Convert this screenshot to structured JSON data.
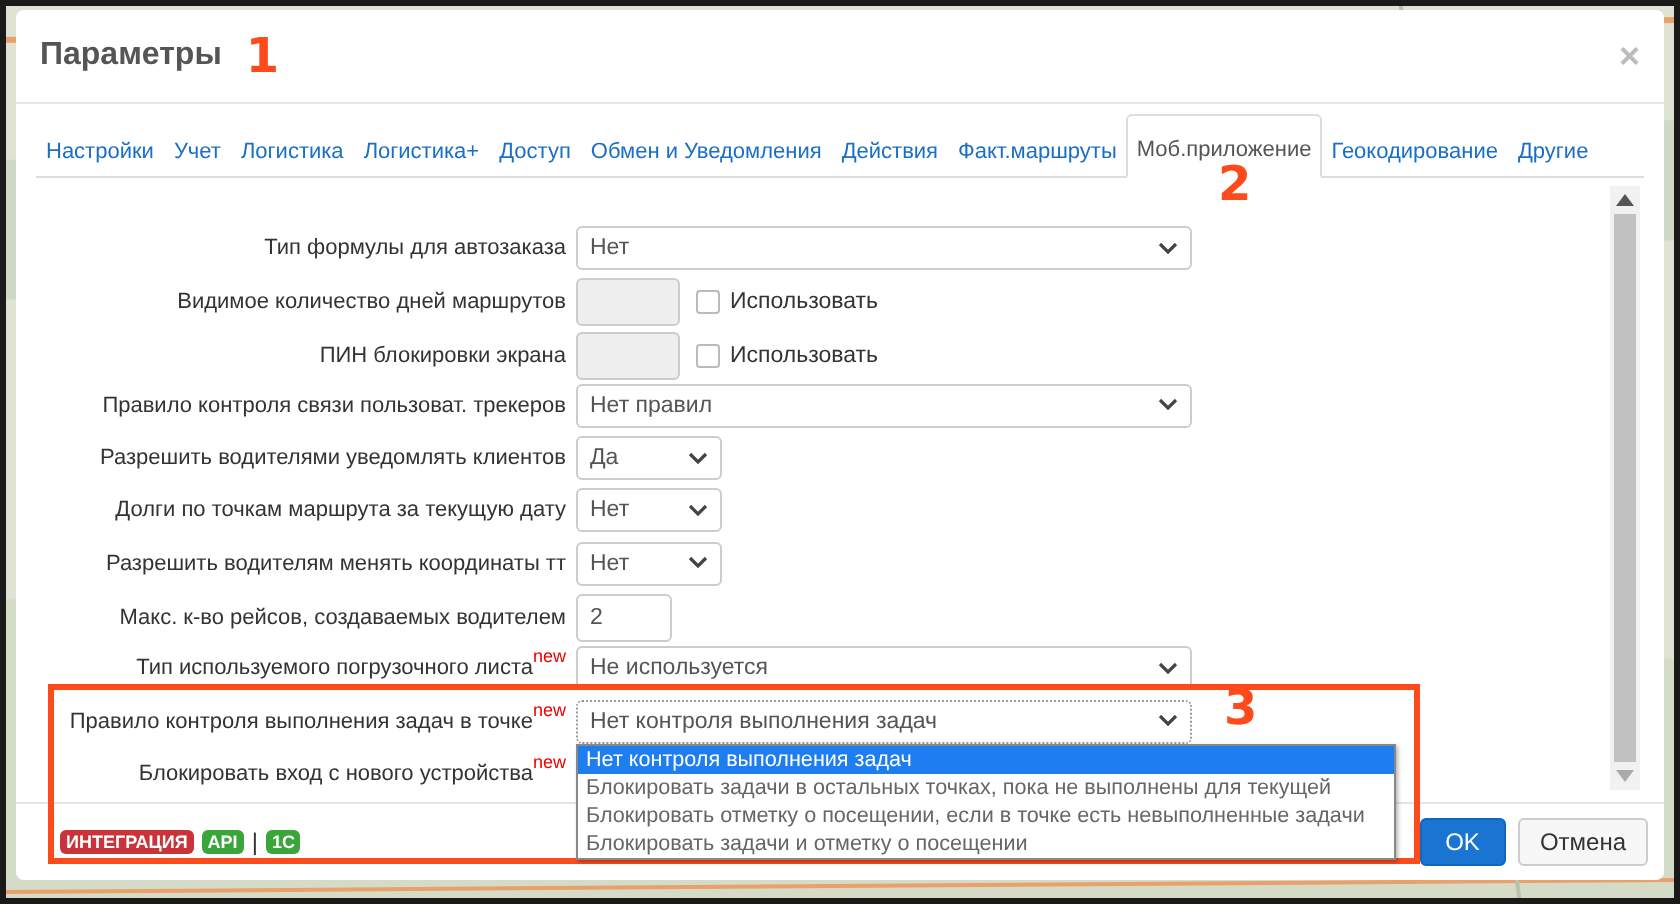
{
  "dialog": {
    "title": "Параметры",
    "close": "×"
  },
  "tabs": [
    {
      "label": "Настройки",
      "selected": false
    },
    {
      "label": "Учет",
      "selected": false
    },
    {
      "label": "Логистика",
      "selected": false
    },
    {
      "label": "Логистика+",
      "selected": false
    },
    {
      "label": "Доступ",
      "selected": false
    },
    {
      "label": "Обмен и Уведомления",
      "selected": false
    },
    {
      "label": "Действия",
      "selected": false
    },
    {
      "label": "Факт.маршруты",
      "selected": false
    },
    {
      "label": "Моб.приложение",
      "selected": true
    },
    {
      "label": "Геокодирование",
      "selected": false
    },
    {
      "label": "Другие",
      "selected": false
    }
  ],
  "rows": [
    {
      "label": "Тип формулы для автозаказа",
      "kind": "select",
      "value": "Нет"
    },
    {
      "label": "Видимое количество дней маршрутов",
      "kind": "locked",
      "checkbox": {
        "label": "Использовать",
        "checked": false
      }
    },
    {
      "label": "ПИН блокировки экрана",
      "kind": "locked",
      "checkbox": {
        "label": "Использовать",
        "checked": false
      }
    },
    {
      "label": "Правило контроля связи пользоват. трекеров",
      "kind": "select",
      "value": "Нет правил"
    },
    {
      "label": "Разрешить водителями уведомлять клиентов",
      "kind": "smallselect",
      "value": "Да"
    },
    {
      "label": "Долги по точкам маршрута за текущую дату",
      "kind": "smallselect",
      "value": "Нет"
    },
    {
      "label": "Разрешить водителям менять координаты тт",
      "kind": "smallselect",
      "value": "Нет"
    },
    {
      "label": "Макс. к-во рейсов, создаваемых водителем",
      "kind": "input",
      "value": "2"
    },
    {
      "label": "Тип используемого погрузочного листа",
      "badge": "new",
      "kind": "select",
      "value": "Не используется"
    },
    {
      "label": "Правило контроля выполнения задач в точке",
      "badge": "new",
      "kind": "select",
      "value": "Нет контроля выполнения задач",
      "expanded": true,
      "options": [
        {
          "label": "Нет контроля выполнения задач",
          "selected": true
        },
        {
          "label": "Блокировать задачи в остальных точках, пока не выполнены для текущей",
          "selected": false
        },
        {
          "label": "Блокировать отметку о посещении, если в точке есть невыполненные задачи",
          "selected": false
        },
        {
          "label": "Блокировать задачи и отметку о посещении",
          "selected": false
        }
      ]
    },
    {
      "label": "Блокировать вход с нового устройства",
      "badge": "new",
      "kind": "hidden"
    }
  ],
  "footer": {
    "tags": [
      {
        "label": "ИНТЕГРАЦИЯ",
        "color": "#c8343a"
      },
      {
        "label": "API",
        "color": "#3aa63a"
      },
      {
        "label": "|",
        "kind": "separator"
      },
      {
        "label": "1C",
        "color": "#3aa63a"
      }
    ],
    "buttons": [
      {
        "label": "OK",
        "kind": "primary"
      },
      {
        "label": "Отмена",
        "kind": "default"
      }
    ]
  },
  "annotations": [
    "1",
    "2",
    "3"
  ]
}
